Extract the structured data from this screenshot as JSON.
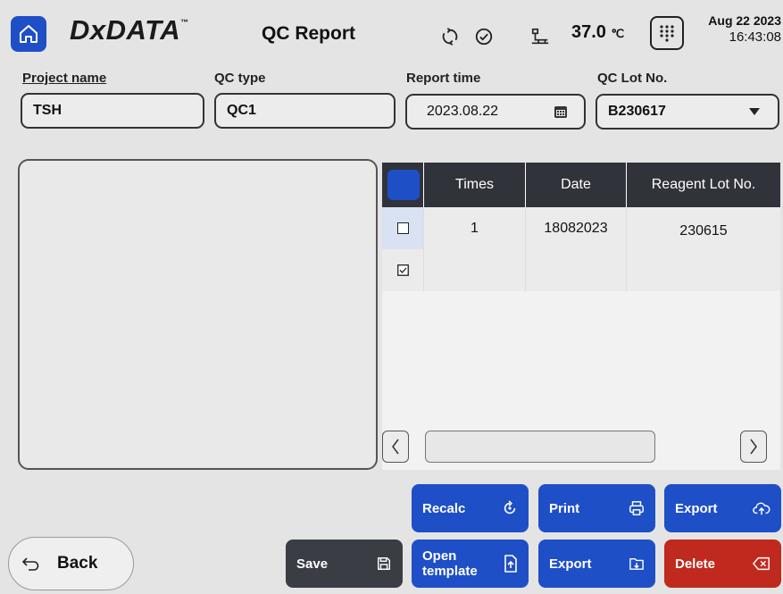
{
  "header": {
    "logo": "DxDATA",
    "logo_mark": "™",
    "title": "QC Report",
    "temperature": "37.0",
    "temperature_unit": "℃",
    "date": "Aug 22 2023",
    "time": "16:43:08"
  },
  "fields": {
    "project_name": {
      "label": "Project name",
      "value": "TSH"
    },
    "qc_type": {
      "label": "QC type",
      "value": "QC1"
    },
    "report_time": {
      "label": "Report time",
      "value": "2023.08.22"
    },
    "qc_lot": {
      "label": "QC Lot No.",
      "value": "B230617"
    }
  },
  "table": {
    "columns": [
      "Times",
      "Date",
      "Reagent Lot No."
    ],
    "rows": [
      {
        "checked": false,
        "times": "1",
        "date": "18082023",
        "reagent_lot": "230615"
      },
      {
        "checked": true,
        "times": "",
        "date": "",
        "reagent_lot": ""
      }
    ]
  },
  "buttons": {
    "recalc": "Recalc",
    "print": "Print",
    "export_cloud": "Export",
    "save": "Save",
    "open_template_line1": "Open",
    "open_template_line2": "template",
    "export_folder": "Export",
    "delete": "Delete",
    "back": "Back"
  },
  "colors": {
    "accent": "#1f4fc7",
    "dark": "#3a3d44",
    "danger": "#c0291e",
    "table_header": "#30333a"
  }
}
